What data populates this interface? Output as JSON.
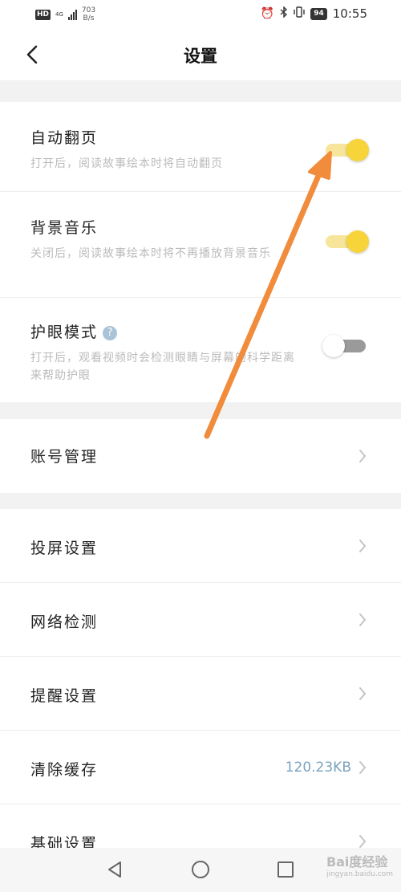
{
  "status_bar": {
    "hd": "HD",
    "net": "4G",
    "speed_value": "703",
    "speed_unit": "B/s",
    "battery": "94",
    "time": "10:55"
  },
  "header": {
    "title": "设置"
  },
  "toggles": [
    {
      "title": "自动翻页",
      "desc": "打开后，阅读故事绘本时将自动翻页",
      "on": true
    },
    {
      "title": "背景音乐",
      "desc": "关闭后，阅读故事绘本时将不再播放背景音乐",
      "on": true
    },
    {
      "title": "护眼模式",
      "desc": "打开后，观看视频时会检测眼睛与屏幕的科学距离来帮助护眼",
      "on": false,
      "help": "?"
    }
  ],
  "account": {
    "label": "账号管理"
  },
  "items": [
    {
      "label": "投屏设置"
    },
    {
      "label": "网络检测"
    },
    {
      "label": "提醒设置"
    },
    {
      "label": "清除缓存",
      "value": "120.23KB"
    },
    {
      "label": "基础设置"
    }
  ],
  "watermark": {
    "brand": "Bai度经验",
    "url": "jingyan.baidu.com"
  },
  "colors": {
    "accent": "#f7d43a",
    "track_on": "#f6e59a",
    "value": "#7aa3bf",
    "annotation": "#f08c3c"
  },
  "icons": {
    "back": "chevron-left-icon",
    "item": "chevron-right-icon",
    "help": "question-circle-icon"
  }
}
